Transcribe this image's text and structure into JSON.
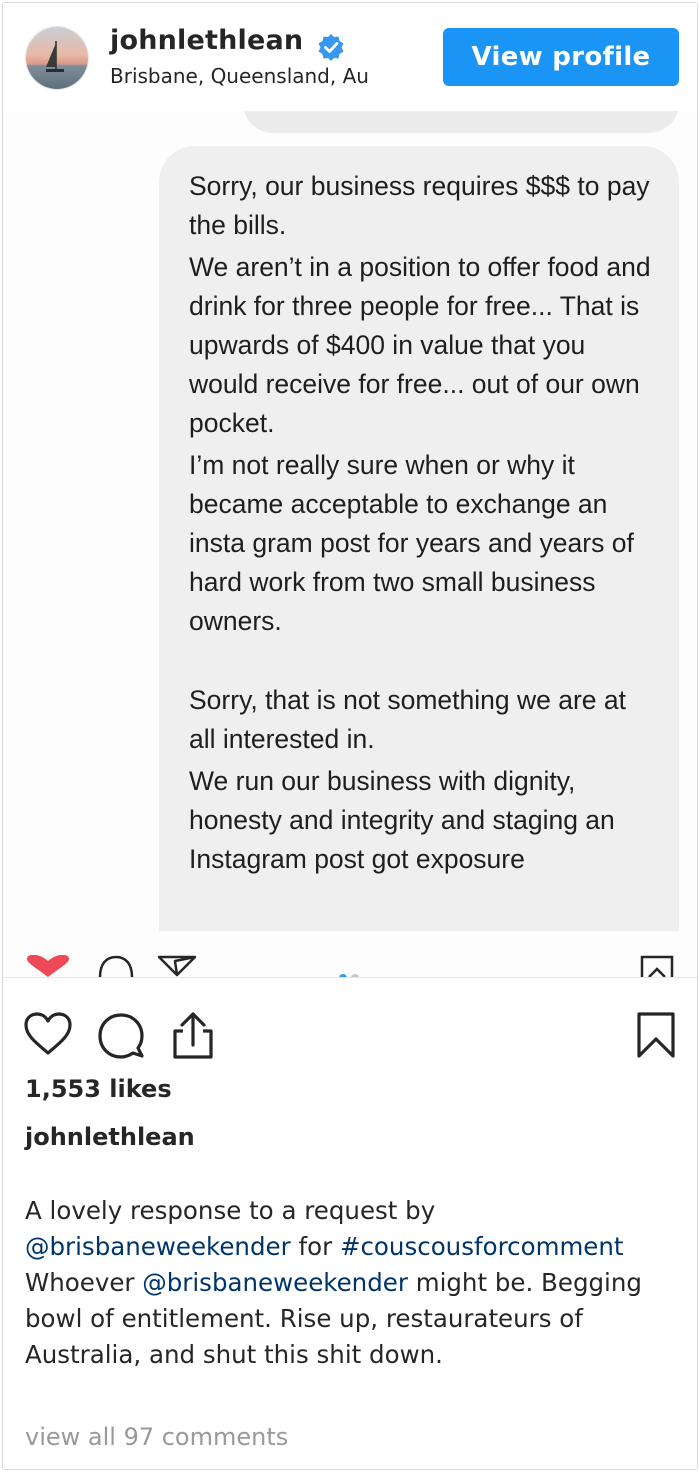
{
  "header": {
    "username": "johnlethlean",
    "location": "Brisbane, Queensland, Au",
    "view_profile_label": "View profile"
  },
  "post_image": {
    "message_paragraphs": [
      "Sorry, our business requires $$$ to pay the bills.",
      "We aren’t in a position to offer food and drink for three people for free... That is upwards of $400 in value that you would receive for free... out of our own pocket.",
      "I’m not really sure when or why it became acceptable to exchange an insta gram post for years and years of hard work from two small business owners.",
      "Sorry, that is not something we are at all interested in.",
      "We run our business with dignity, honesty and integrity and staging an Instagram post got exposure"
    ],
    "carousel_index": 1,
    "carousel_total": 2
  },
  "post": {
    "likes_text": "1,553 likes",
    "author": "johnlethlean",
    "caption": {
      "part1": "A lovely response to a request by ",
      "mention1": "@brisbaneweekender",
      "part2": " for ",
      "hashtag": "#couscousforcomment",
      "part3": " Whoever ",
      "mention2": "@brisbaneweekender",
      "part4": " might be. Begging bowl of entitlement. Rise up, restaurateurs of Australia, and shut this shit down."
    },
    "view_comments": "view all 97 comments"
  },
  "colors": {
    "accent": "#1b95f5",
    "link": "#003569",
    "verified": "#3897f0",
    "heart": "#ed4956"
  },
  "icons": [
    "verified-badge-icon",
    "heart-icon",
    "comment-icon",
    "share-icon",
    "bookmark-icon",
    "direct-icon"
  ]
}
